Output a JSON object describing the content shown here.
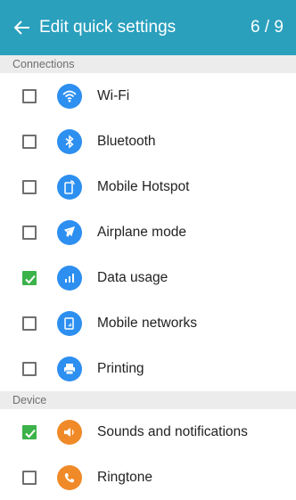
{
  "appbar": {
    "title": "Edit quick settings",
    "count": "6 / 9"
  },
  "sections": [
    {
      "header": "Connections",
      "items": [
        {
          "label": "Wi-Fi",
          "checked": false,
          "icon": "wifi-icon"
        },
        {
          "label": "Bluetooth",
          "checked": false,
          "icon": "bluetooth-icon"
        },
        {
          "label": "Mobile Hotspot",
          "checked": false,
          "icon": "hotspot-icon"
        },
        {
          "label": "Airplane mode",
          "checked": false,
          "icon": "airplane-icon"
        },
        {
          "label": "Data usage",
          "checked": true,
          "icon": "data-usage-icon"
        },
        {
          "label": "Mobile networks",
          "checked": false,
          "icon": "mobile-networks-icon"
        },
        {
          "label": "Printing",
          "checked": false,
          "icon": "printer-icon"
        }
      ]
    },
    {
      "header": "Device",
      "items": [
        {
          "label": "Sounds and notifications",
          "checked": true,
          "icon": "sound-icon"
        },
        {
          "label": "Ringtone",
          "checked": false,
          "icon": "ringtone-icon"
        }
      ]
    }
  ],
  "colors": {
    "appbar": "#2aa0bd",
    "blue_icon": "#2d8ff0",
    "orange_icon": "#f08a28",
    "checked": "#3cb24a"
  }
}
